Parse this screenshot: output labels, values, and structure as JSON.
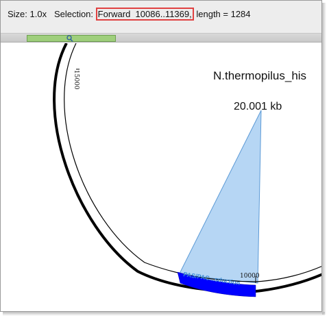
{
  "status": {
    "size_label": "Size: 1.0x",
    "selection_label": "Selection:",
    "selection_value": "Forward  10086..11369,",
    "length_text": "length = 1284"
  },
  "map": {
    "sequence_name": "N.thermopilus_his",
    "sequence_length": "20.001 kb",
    "tick_15000": "15000",
    "tick_10000": "10000",
    "feature_label": "PAS/PAC...sduction"
  },
  "colors": {
    "selection_wedge": "#9ec8f0",
    "feature": "#0000ff",
    "highlight_border": "#e04040",
    "scroll_thumb": "#9fcf7c"
  },
  "icons": {
    "scroll_thumb": "magnifier-icon"
  }
}
